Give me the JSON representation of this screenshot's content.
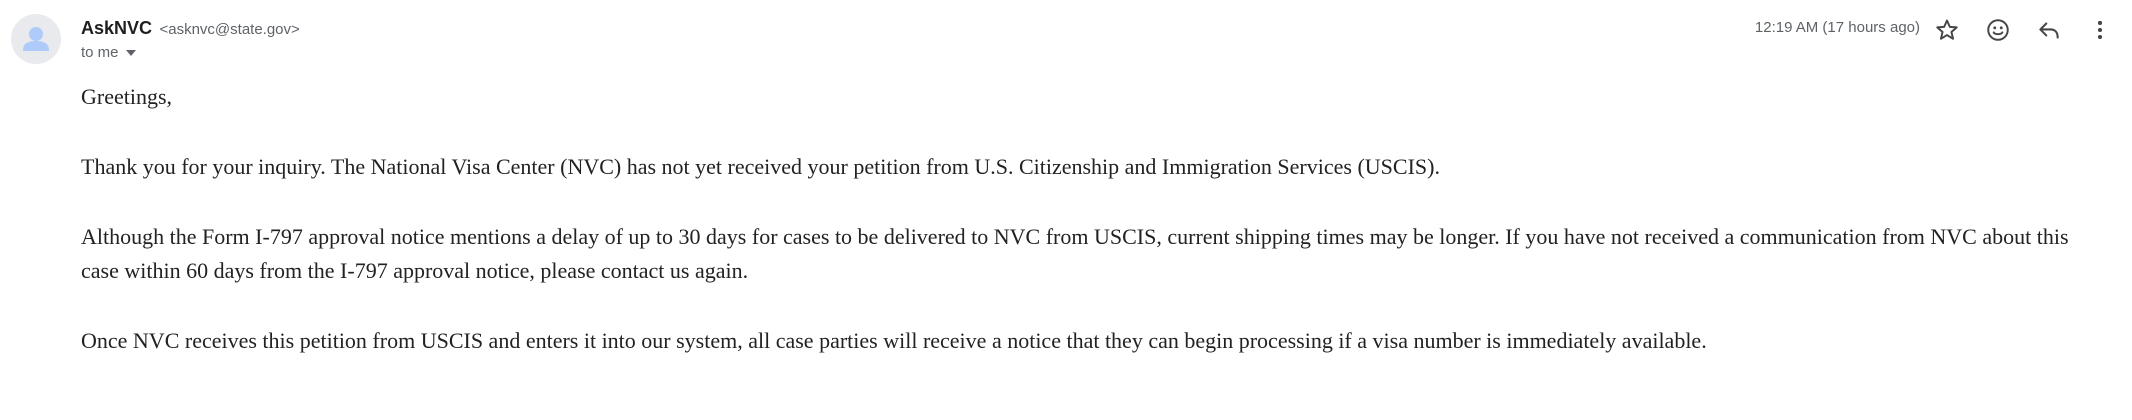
{
  "sender": {
    "name": "AskNVC",
    "email": "<asknvc@state.gov>"
  },
  "recipient": {
    "label": "to me",
    "expand_icon": "caret-down-icon"
  },
  "timestamp": "12:19 AM (17 hours ago)",
  "toolbar": {
    "star_icon": "star-outline-icon",
    "emoji_icon": "add-reaction-icon",
    "reply_icon": "reply-icon",
    "more_icon": "more-vert-icon"
  },
  "message": {
    "greeting": "Greetings,",
    "paragraph1": "Thank you for your inquiry. The National Visa Center (NVC) has not yet received your petition from U.S. Citizenship and Immigration Services (USCIS).",
    "paragraph2": "Although the Form I-797 approval notice mentions a delay of up to 30 days for cases to be delivered to NVC from USCIS, current shipping times may be longer. If you have not received a communication from NVC about this case within 60 days from the I-797 approval notice, please contact us again.",
    "paragraph3": "Once NVC receives this petition from USCIS and enters it into our system, all case parties will receive a notice that they can begin processing if a visa number is immediately available."
  },
  "colors": {
    "avatar_bg": "#e8eaed",
    "avatar_fg": "#aecbfa",
    "muted_text": "#5f6368",
    "icon": "#444746",
    "body_text": "#222222"
  }
}
